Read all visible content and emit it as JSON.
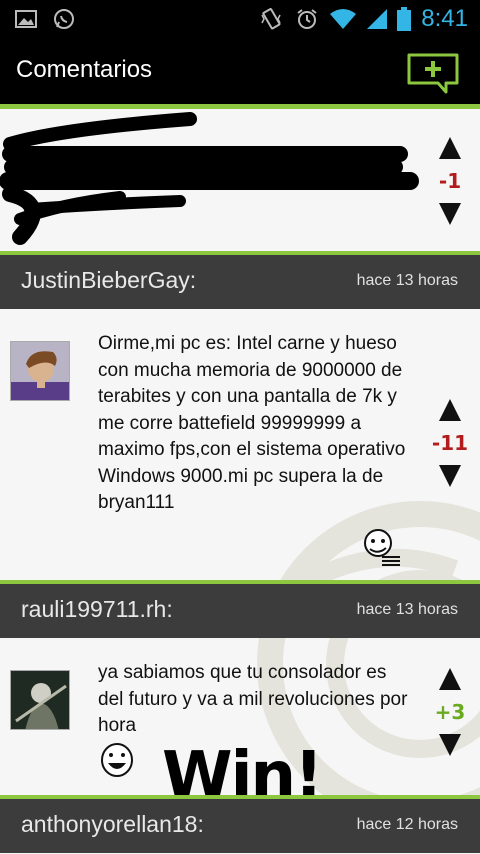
{
  "status_bar": {
    "time": "8:41"
  },
  "action_bar": {
    "title": "Comentarios"
  },
  "posts": [
    {
      "user": "",
      "time_ago": "",
      "score": "-1",
      "score_color": "#b31c1c",
      "text": ""
    },
    {
      "user": "JustinBieberGay:",
      "time_ago": "hace 13 horas",
      "score": "-11",
      "score_color": "#b31c1c",
      "text": "Oirme,mi pc es: Intel carne y hueso con mucha memoria de 9000000 de terabites y con una pantalla de 7k y me corre battefield 99999999 a maximo fps,con el sistema operativo Windows 9000.mi pc supera la de bryan111"
    },
    {
      "user": "rauli199711.rh:",
      "time_ago": "hace 13 horas",
      "score": "+3",
      "score_color": "#6aaa1f",
      "text": "ya sabiamos que tu consolador es del futuro y va a mil revoluciones por hora",
      "image_text": "Win!"
    },
    {
      "user": "anthonyorellan18:",
      "time_ago": "hace 12 horas"
    }
  ],
  "colors": {
    "accent": "#8dc63f",
    "header_bg": "#3c3c3c",
    "time_blue": "#33b5e5"
  }
}
